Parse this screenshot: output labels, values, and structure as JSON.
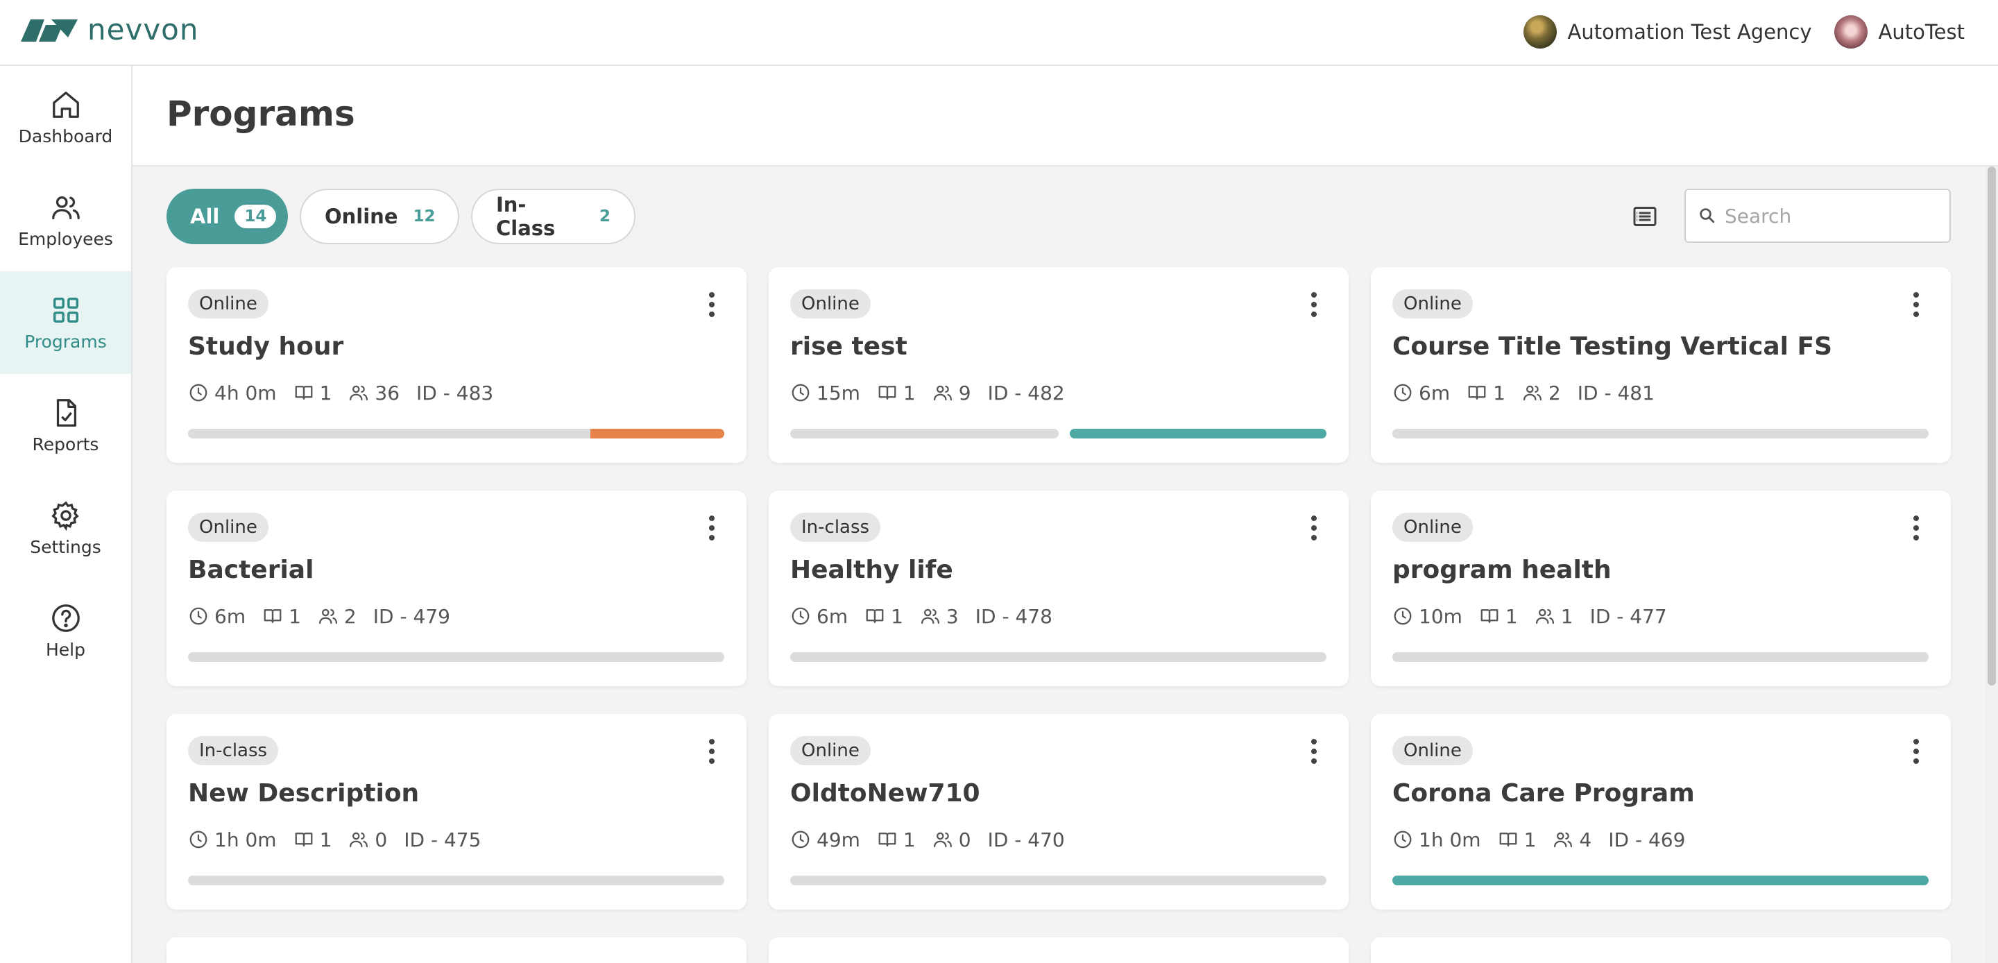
{
  "app": {
    "brand": "nevvon",
    "agency": "Automation Test Agency",
    "user": "AutoTest",
    "brand_color": "#2e6e6a",
    "accent_color": "#4a9c98"
  },
  "sidebar": {
    "items": [
      {
        "label": "Dashboard",
        "icon": "home-icon",
        "active": false
      },
      {
        "label": "Employees",
        "icon": "users-icon",
        "active": false
      },
      {
        "label": "Programs",
        "icon": "grid-icon",
        "active": true
      },
      {
        "label": "Reports",
        "icon": "report-icon",
        "active": false
      },
      {
        "label": "Settings",
        "icon": "gear-icon",
        "active": false
      },
      {
        "label": "Help",
        "icon": "help-icon",
        "active": false
      }
    ]
  },
  "page": {
    "title": "Programs"
  },
  "filters": {
    "all": {
      "label": "All",
      "count": "14"
    },
    "online": {
      "label": "Online",
      "count": "12"
    },
    "inclass": {
      "label": "In-Class",
      "count": "2"
    }
  },
  "search": {
    "placeholder": "Search",
    "value": ""
  },
  "programs": [
    {
      "type": "Online",
      "title": "Study hour",
      "duration": "4h 0m",
      "modules": "1",
      "users": "36",
      "id": "ID - 483",
      "progress": {
        "style": "split",
        "gray": 0.75,
        "accent": "orange"
      }
    },
    {
      "type": "Online",
      "title": "rise test",
      "duration": "15m",
      "modules": "1",
      "users": "9",
      "id": "ID - 482",
      "progress": {
        "style": "split",
        "gray": 0.5,
        "accent": "teal"
      }
    },
    {
      "type": "Online",
      "title": "Course Title Testing Vertical FS",
      "duration": "6m",
      "modules": "1",
      "users": "2",
      "id": "ID - 481",
      "progress": {
        "style": "empty"
      }
    },
    {
      "type": "Online",
      "title": "Bacterial",
      "duration": "6m",
      "modules": "1",
      "users": "2",
      "id": "ID - 479",
      "progress": {
        "style": "empty"
      }
    },
    {
      "type": "In-class",
      "title": "Healthy life",
      "duration": "6m",
      "modules": "1",
      "users": "3",
      "id": "ID - 478",
      "progress": {
        "style": "empty"
      }
    },
    {
      "type": "Online",
      "title": "program health",
      "duration": "10m",
      "modules": "1",
      "users": "1",
      "id": "ID - 477",
      "progress": {
        "style": "empty"
      }
    },
    {
      "type": "In-class",
      "title": "New Description",
      "duration": "1h 0m",
      "modules": "1",
      "users": "0",
      "id": "ID - 475",
      "progress": {
        "style": "empty"
      }
    },
    {
      "type": "Online",
      "title": "OldtoNew710",
      "duration": "49m",
      "modules": "1",
      "users": "0",
      "id": "ID - 470",
      "progress": {
        "style": "empty"
      }
    },
    {
      "type": "Online",
      "title": "Corona Care Program",
      "duration": "1h 0m",
      "modules": "1",
      "users": "4",
      "id": "ID - 469",
      "progress": {
        "style": "full",
        "accent": "teal"
      }
    }
  ]
}
